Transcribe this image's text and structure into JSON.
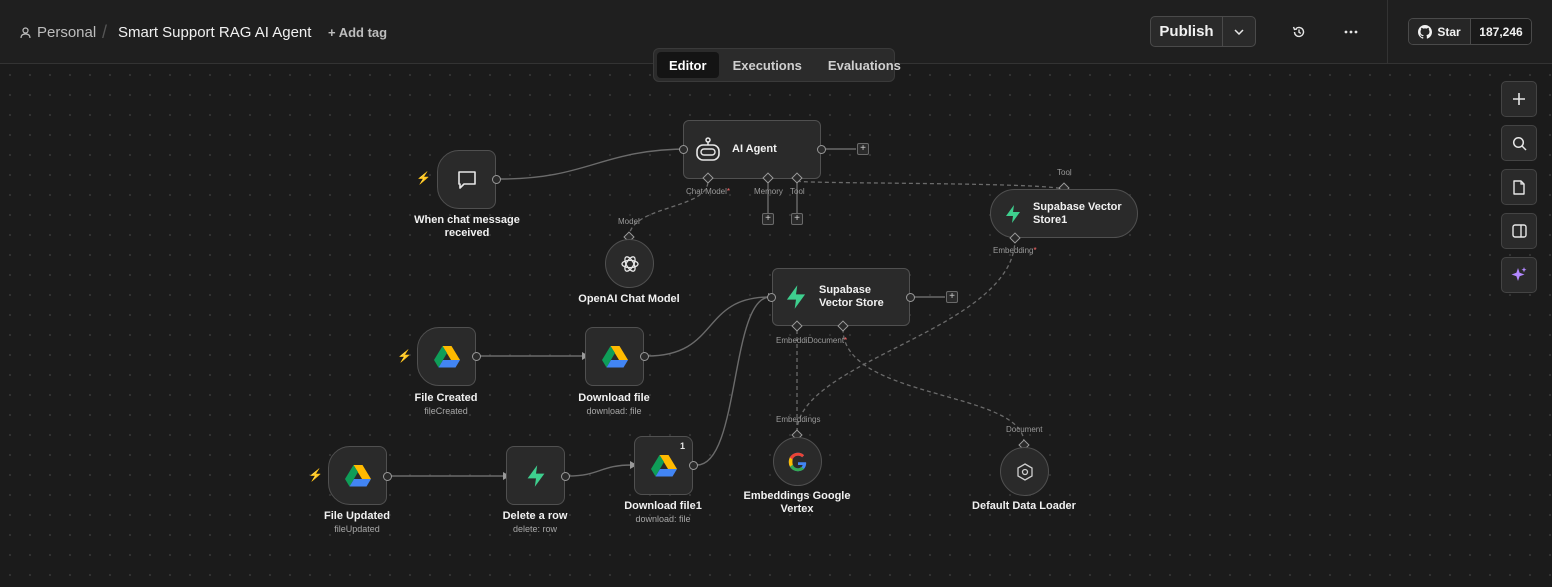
{
  "header": {
    "breadcrumb_personal": "Personal",
    "workflow_title": "Smart Support RAG AI Agent",
    "add_tag": "+ Add tag",
    "publish_label": "Publish",
    "github_star_label": "Star",
    "github_star_count": "187,246"
  },
  "tabs": [
    {
      "label": "Editor",
      "active": true
    },
    {
      "label": "Executions",
      "active": false
    },
    {
      "label": "Evaluations",
      "active": false
    }
  ],
  "nodes": {
    "chat_trigger": {
      "label": "When chat message received",
      "icon": "chat-bubble-icon"
    },
    "ai_agent": {
      "label": "AI Agent",
      "icon": "robot-icon"
    },
    "openai_model": {
      "label": "OpenAI Chat Model",
      "icon": "openai-icon"
    },
    "supabase_store1": {
      "label": "Supabase Vector Store1",
      "icon": "supabase-icon"
    },
    "supabase_store": {
      "label": "Supabase Vector Store",
      "icon": "supabase-icon"
    },
    "file_created": {
      "label": "File Created",
      "sublabel": "fileCreated",
      "icon": "google-drive-icon"
    },
    "download_file": {
      "label": "Download file",
      "sublabel": "download: file",
      "icon": "google-drive-icon"
    },
    "file_updated": {
      "label": "File Updated",
      "sublabel": "fileUpdated",
      "icon": "google-drive-icon"
    },
    "delete_row": {
      "label": "Delete a row",
      "sublabel": "delete: row",
      "icon": "supabase-icon"
    },
    "download_file1": {
      "label": "Download file1",
      "sublabel": "download: file",
      "badge": "1",
      "icon": "google-drive-icon"
    },
    "embeddings_google": {
      "label": "Embeddings Google Vertex",
      "icon": "google-icon"
    },
    "default_loader": {
      "label": "Default Data Loader",
      "icon": "loader-icon"
    }
  },
  "ports": {
    "chat_model": "Chat Model",
    "memory": "Memory",
    "tool": "Tool",
    "model": "Model",
    "tool_top": "Tool",
    "embedding": "Embedding",
    "embedding_doc": "EmbeddiDocument",
    "embeddings": "Embeddings",
    "document": "Document",
    "required_mark": "*"
  },
  "colors": {
    "background": "#1b1b1b",
    "node_bg": "#2a2a2a",
    "trigger_bolt": "#ff6d5a",
    "supabase_green": "#3ecf8e",
    "ai_sparkle": "#b388ff"
  }
}
